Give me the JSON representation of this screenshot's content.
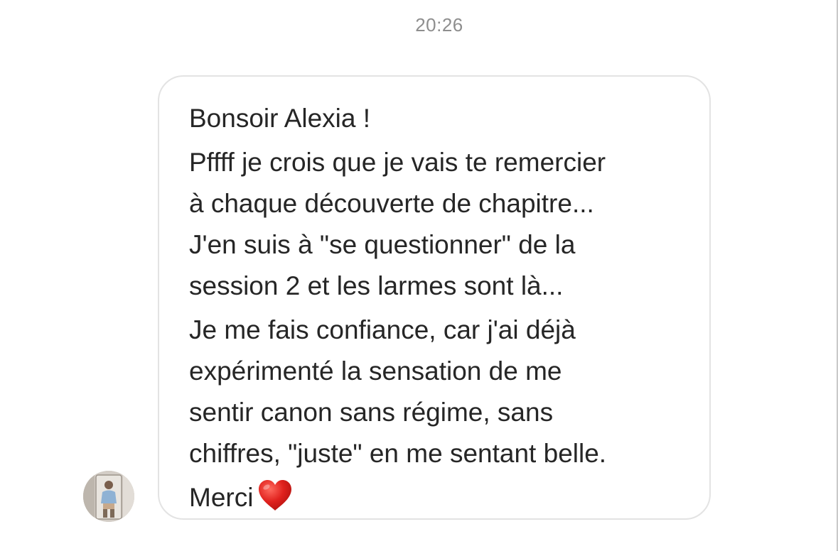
{
  "timestamp": "20:26",
  "message": {
    "paragraphs": [
      "Bonsoir Alexia !",
      "Pffff je crois que je vais te remercier\nà chaque découverte de chapitre...\nJ'en suis à \"se questionner\" de la\nsession 2 et les larmes sont là...",
      "Je me fais confiance, car j'ai déjà\nexpérimenté la sensation de me\nsentir canon sans régime, sans\nchiffres, \"juste\" en me sentant belle."
    ],
    "closing": "Merci",
    "closing_emoji": "red-heart-icon"
  },
  "sender": {
    "avatar_icon": "profile-photo"
  },
  "colors": {
    "text": "#262626",
    "timestamp": "#8e8e8e",
    "bubble_border": "#e3e3e3",
    "heart": "#e0211d"
  }
}
